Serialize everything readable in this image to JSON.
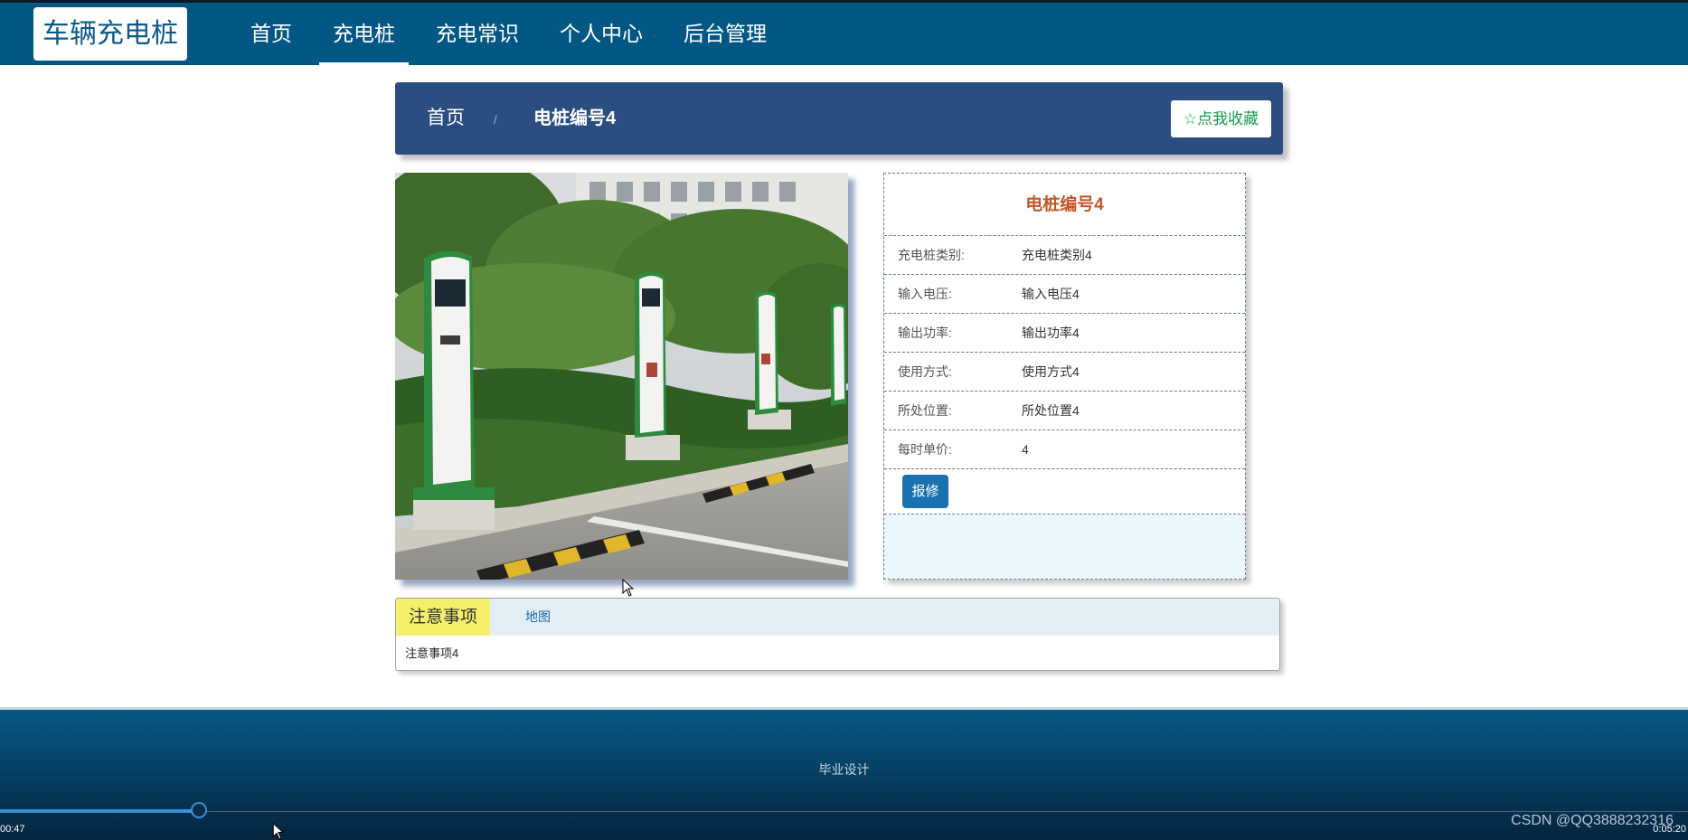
{
  "header": {
    "brand": "车辆充电桩",
    "nav": [
      {
        "label": "首页",
        "active": false
      },
      {
        "label": "充电桩",
        "active": true
      },
      {
        "label": "充电常识",
        "active": false
      },
      {
        "label": "个人中心",
        "active": false
      },
      {
        "label": "后台管理",
        "active": false
      }
    ]
  },
  "breadcrumb": {
    "home": "首页",
    "separator": "/",
    "current": "电桩编号4",
    "favorite_label": "☆点我收藏"
  },
  "detail": {
    "title": "电桩编号4",
    "fields": [
      {
        "label": "充电桩类别:",
        "value": "充电桩类别4"
      },
      {
        "label": "输入电压:",
        "value": "输入电压4"
      },
      {
        "label": "输出功率:",
        "value": "输出功率4"
      },
      {
        "label": "使用方式:",
        "value": "使用方式4"
      },
      {
        "label": "所处位置:",
        "value": "所处位置4"
      },
      {
        "label": "每时单价:",
        "value": "4"
      }
    ],
    "repair_label": "报修"
  },
  "tabs": {
    "items": [
      {
        "label": "注意事项",
        "active": true
      },
      {
        "label": "地图",
        "active": false
      }
    ],
    "content": "注意事项4"
  },
  "footer": {
    "text": "毕业设计"
  },
  "player": {
    "current_time": "00:47",
    "total_time": "0:05:20",
    "progress_fraction": 0.119,
    "watermark": "CSDN @QQ3888232316"
  },
  "colors": {
    "navbar": "#035785",
    "breadcrumb": "#2b4d82",
    "title_accent": "#c2572c",
    "favorite": "#13a04a",
    "repair_button": "#1a72b0",
    "tab_active": "#f4f06a"
  }
}
